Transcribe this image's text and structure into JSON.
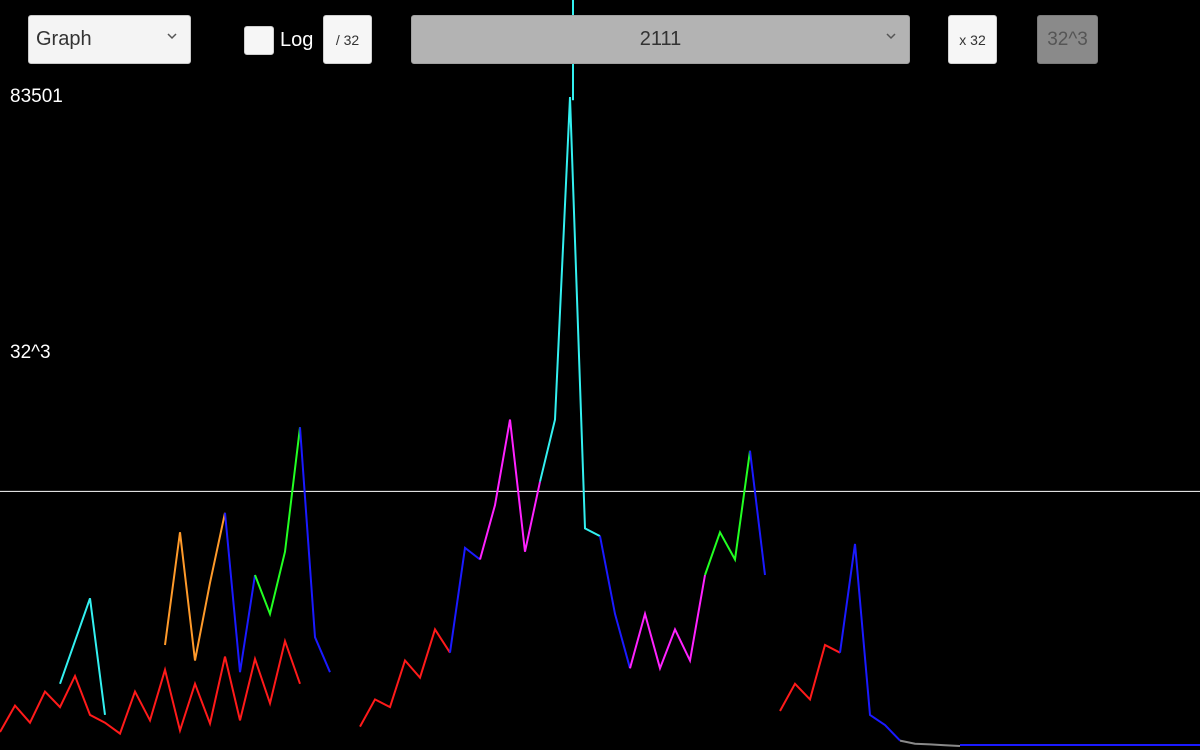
{
  "controls": {
    "mode_select": {
      "value": "Graph",
      "icon": "chevron-down-icon"
    },
    "log_toggle": {
      "label": "Log",
      "checked": false
    },
    "divide_button": {
      "label": "/ 32"
    },
    "value_select": {
      "value": "2111",
      "icon": "chevron-down-icon"
    },
    "multiply_button": {
      "label": "x 32"
    },
    "preset_button": {
      "label": "32^3"
    }
  },
  "axis": {
    "max_label": "83501",
    "reference_label": "32^3"
  },
  "colors": {
    "background": "#000000",
    "reference_line": "#ffffff",
    "red": "#ff1a1a",
    "cyan": "#33f0f0",
    "orange": "#ff9a2a",
    "blue": "#1a1aff",
    "green": "#22ff22",
    "magenta": "#ff22ff",
    "gray": "#8a8a8a"
  },
  "chart_data": {
    "type": "line",
    "ylim": [
      0,
      83501
    ],
    "reference_value": 32768,
    "highlight_x": 0.4775,
    "x": [
      0,
      0.0125,
      0.025,
      0.0375,
      0.05,
      0.0625,
      0.075,
      0.0875,
      0.1,
      0.1125,
      0.125,
      0.1375,
      0.15,
      0.1625,
      0.175,
      0.1875,
      0.2,
      0.2125,
      0.225,
      0.2375,
      0.25,
      0.2625,
      0.275,
      0.2875,
      0.3,
      0.3125,
      0.325,
      0.3375,
      0.35,
      0.3625,
      0.375,
      0.3875,
      0.4,
      0.4125,
      0.425,
      0.4375,
      0.45,
      0.4625,
      0.475,
      0.4875,
      0.5,
      0.5125,
      0.525,
      0.5375,
      0.55,
      0.5625,
      0.575,
      0.5875,
      0.6,
      0.6125,
      0.625,
      0.6375,
      0.65,
      0.6625,
      0.675,
      0.6875,
      0.7,
      0.7125,
      0.725,
      0.7375,
      0.75,
      0.7625,
      0.775,
      0.7875,
      0.8,
      1.0
    ],
    "values": [
      1800,
      5200,
      3000,
      12000,
      13000,
      3000,
      5500,
      2500,
      4800,
      6000,
      8500,
      19000,
      17000,
      24000,
      10500,
      19000,
      3200,
      12500,
      4800,
      24000,
      2000,
      8000,
      0,
      2500,
      4000,
      7000,
      12000,
      22000,
      35000,
      45000,
      38000,
      39000,
      57000,
      79000,
      36000,
      31000,
      12000,
      9000,
      5000,
      10000,
      15000,
      13000,
      11500,
      29000,
      31500,
      9000,
      900,
      2900,
      4600,
      300,
      3000,
      1000,
      12500,
      0,
      0,
      0,
      0,
      0,
      0,
      0,
      0,
      0,
      0,
      0,
      0,
      0
    ],
    "series": [
      {
        "name": "",
        "color": "red",
        "x": [
          0.0,
          0.0125,
          0.025,
          0.0375,
          0.05,
          0.0625,
          0.075,
          0.0875,
          0.1,
          0.1125,
          0.125,
          0.1375,
          0.15,
          0.1625,
          0.175,
          0.1875,
          0.2,
          0.2125,
          0.225,
          0.2375,
          0.25
        ],
        "values": [
          1800,
          5200,
          3000,
          7000,
          5000,
          9000,
          4000,
          3000,
          1600,
          7000,
          3300,
          9800,
          2000,
          8000,
          2900,
          11500,
          3300,
          11200,
          5500,
          13500,
          8000
        ]
      },
      {
        "name": "",
        "color": "cyan",
        "x": [
          0.05,
          0.0625,
          0.075,
          0.0875
        ],
        "values": [
          8000,
          13500,
          19000,
          4000
        ]
      },
      {
        "name": "",
        "color": "orange",
        "x": [
          0.1375,
          0.15,
          0.1625,
          0.175,
          0.1875
        ],
        "values": [
          13000,
          27500,
          11000,
          21000,
          30000
        ]
      },
      {
        "name": "",
        "color": "blue",
        "x": [
          0.1875,
          0.2,
          0.2125
        ],
        "values": [
          30000,
          9500,
          22000
        ]
      },
      {
        "name": "",
        "color": "green",
        "x": [
          0.2125,
          0.225,
          0.2375,
          0.25
        ],
        "values": [
          22000,
          17000,
          25000,
          41000
        ]
      },
      {
        "name": "",
        "color": "blue",
        "x": [
          0.25,
          0.2625,
          0.275
        ],
        "values": [
          41000,
          14000,
          9500
        ]
      },
      {
        "name": "",
        "color": "red",
        "x": [
          0.3,
          0.3125,
          0.325,
          0.3375,
          0.35,
          0.3625,
          0.375
        ],
        "values": [
          2500,
          6000,
          5000,
          11000,
          8800,
          15000,
          12000
        ]
      },
      {
        "name": "",
        "color": "blue",
        "x": [
          0.375,
          0.3875,
          0.4
        ],
        "values": [
          12000,
          25500,
          24000
        ]
      },
      {
        "name": "",
        "color": "magenta",
        "x": [
          0.4,
          0.4125,
          0.425,
          0.4375,
          0.45
        ],
        "values": [
          24000,
          31000,
          42000,
          25000,
          34000
        ]
      },
      {
        "name": "",
        "color": "cyan",
        "x": [
          0.45,
          0.4625,
          0.475,
          0.4875,
          0.5
        ],
        "values": [
          34000,
          42000,
          83500,
          28000,
          27000
        ]
      },
      {
        "name": "",
        "color": "blue",
        "x": [
          0.5,
          0.5125,
          0.525
        ],
        "values": [
          27000,
          17000,
          10000
        ]
      },
      {
        "name": "",
        "color": "magenta",
        "x": [
          0.525,
          0.5375,
          0.55,
          0.5625,
          0.575,
          0.5875
        ],
        "values": [
          10000,
          17000,
          10000,
          15000,
          11000,
          22000
        ]
      },
      {
        "name": "",
        "color": "green",
        "x": [
          0.5875,
          0.6,
          0.6125,
          0.625
        ],
        "values": [
          22000,
          27500,
          24000,
          38000
        ]
      },
      {
        "name": "",
        "color": "blue",
        "x": [
          0.625,
          0.6375
        ],
        "values": [
          38000,
          22000
        ]
      },
      {
        "name": "",
        "color": "red",
        "x": [
          0.65,
          0.6625,
          0.675,
          0.6875,
          0.7
        ],
        "values": [
          4500,
          8000,
          6000,
          13000,
          12000
        ]
      },
      {
        "name": "",
        "color": "blue",
        "x": [
          0.7,
          0.7125,
          0.725,
          0.7375,
          0.75
        ],
        "values": [
          12000,
          26000,
          4000,
          2700,
          700
        ]
      },
      {
        "name": "",
        "color": "gray",
        "x": [
          0.75,
          0.7625,
          0.775,
          0.7875,
          0.8
        ],
        "values": [
          700,
          300,
          200,
          100,
          0
        ]
      }
    ]
  }
}
